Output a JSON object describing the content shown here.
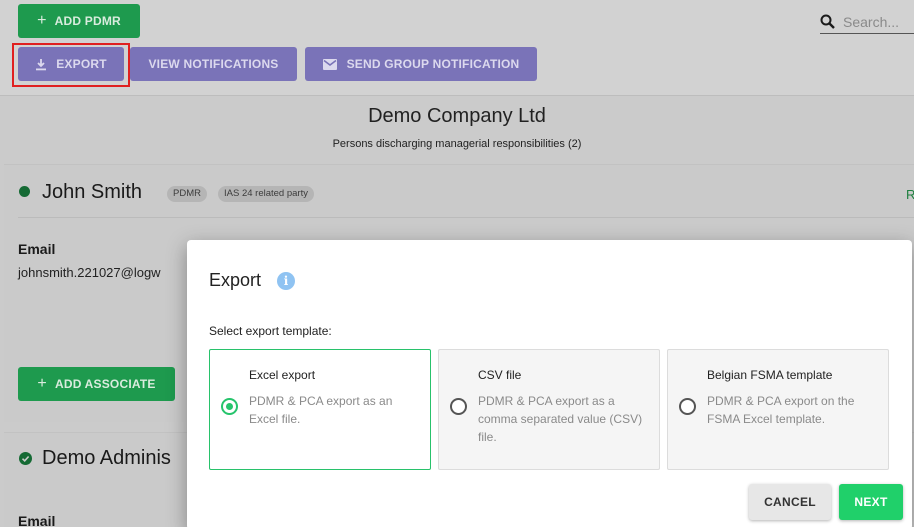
{
  "toolbar": {
    "add_pdmr": "ADD PDMR",
    "export": "EXPORT",
    "view_notifications": "VIEW NOTIFICATIONS",
    "send_group_notification": "SEND GROUP NOTIFICATION",
    "search_placeholder": "Search..."
  },
  "company": {
    "name": "Demo Company Ltd",
    "subtitle": "Persons discharging managerial responsibilities (2)"
  },
  "persons": [
    {
      "name": "John Smith",
      "chips": [
        "PDMR",
        "IAS 24 related party"
      ],
      "status_letter": "R",
      "email_label": "Email",
      "email": "johnsmith.221027@logw",
      "add_associate": "ADD ASSOCIATE"
    },
    {
      "name": "Demo Adminis",
      "email_label": "Email"
    }
  ],
  "modal": {
    "title": "Export",
    "select_label": "Select export template:",
    "options": [
      {
        "title": "Excel export",
        "description": "PDMR & PCA export as an Excel file.",
        "selected": true
      },
      {
        "title": "CSV file",
        "description": "PDMR & PCA export as a comma separated value (CSV) file.",
        "selected": false
      },
      {
        "title": "Belgian FSMA template",
        "description": "PDMR & PCA export on the FSMA Excel template.",
        "selected": false
      }
    ],
    "cancel": "CANCEL",
    "next": "NEXT"
  },
  "colors": {
    "accent_green": "#20d06a",
    "purple": "#7a73b8",
    "highlight_red": "#e02020",
    "info_blue": "#8fc3f2"
  }
}
